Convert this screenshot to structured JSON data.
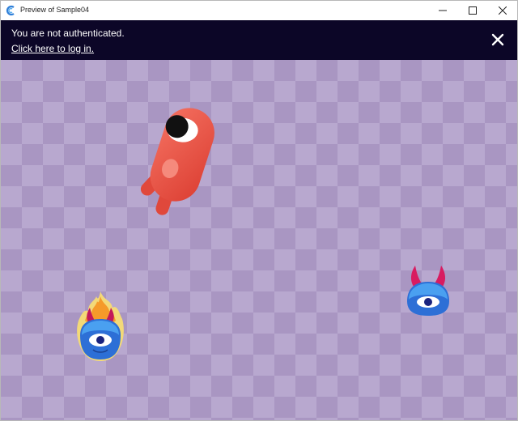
{
  "window": {
    "title": "Preview of Sample04",
    "icon": "app-logo-icon",
    "controls": [
      "minimize-icon",
      "maximize-icon",
      "close-icon"
    ]
  },
  "banner": {
    "message": "You are not authenticated.",
    "link": "Click here to log in.",
    "close_icon": "close-icon"
  },
  "scene": {
    "sprites": [
      "red-cyclops-monster",
      "flaming-blue-monster",
      "horned-blue-monster"
    ]
  },
  "colors": {
    "banner_bg": "#0c0627",
    "checker_light": "#b8a8cf",
    "checker_dark": "#a996c2",
    "red_monster": "#ee5a4d",
    "blue_monster": "#2d6fd6"
  }
}
